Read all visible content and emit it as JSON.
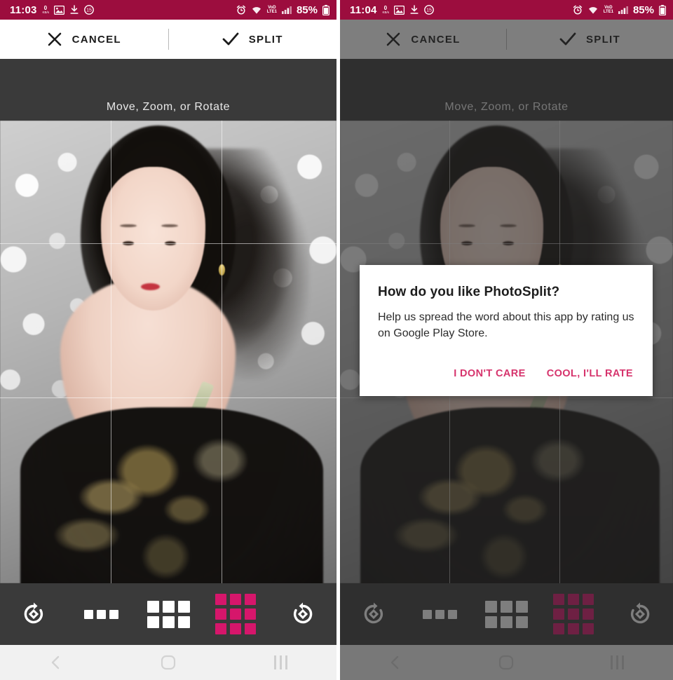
{
  "app": {
    "name": "PhotoSplit",
    "accent_pink": "#d6336c",
    "accent_grid_pink": "#d6166b",
    "statusbar_maroon": "#9c0d3e",
    "editor_gray": "#3a3a3a"
  },
  "left_phone": {
    "statusbar": {
      "time": "11:03",
      "netspeed_value": "0",
      "netspeed_unit": "KB/s",
      "icons": [
        "image-icon",
        "download-complete-icon",
        "dnd-icon",
        "alarm-icon",
        "wifi-icon",
        "volte-lte-icon",
        "signal-bars-icon",
        "battery-icon"
      ],
      "battery_percent": "85%"
    },
    "toolbar": {
      "cancel_label": "CANCEL",
      "split_label": "SPLIT"
    },
    "editor": {
      "hint": "Move, Zoom, or Rotate"
    },
    "tools": [
      {
        "name": "rotate-clockwise",
        "label": "Rotate right"
      },
      {
        "name": "grid-3x1",
        "label": "3 x 1 grid",
        "selected": false
      },
      {
        "name": "grid-3x2",
        "label": "3 x 2 grid",
        "selected": false
      },
      {
        "name": "grid-3x3",
        "label": "3 x 3 grid",
        "selected": true
      },
      {
        "name": "rotate-counterclockwise",
        "label": "Rotate left"
      }
    ],
    "navbar": {
      "back": "back-icon",
      "home": "home-icon",
      "recents": "recents-icon",
      "style": "light"
    }
  },
  "right_phone": {
    "statusbar": {
      "time": "11:04",
      "netspeed_value": "0",
      "netspeed_unit": "KB/s",
      "battery_percent": "85%"
    },
    "toolbar": {
      "cancel_label": "CANCEL",
      "split_label": "SPLIT"
    },
    "editor": {
      "hint": "Move, Zoom, or Rotate"
    },
    "dialog": {
      "title": "How do you like PhotoSplit?",
      "body": "Help us spread the word about this app by rating us on Google Play Store.",
      "negative_label": "I DON'T CARE",
      "positive_label": "COOL, I'LL RATE"
    },
    "navbar": {
      "back": "back-icon",
      "home": "home-icon",
      "recents": "recents-icon",
      "style": "dimmed"
    }
  }
}
